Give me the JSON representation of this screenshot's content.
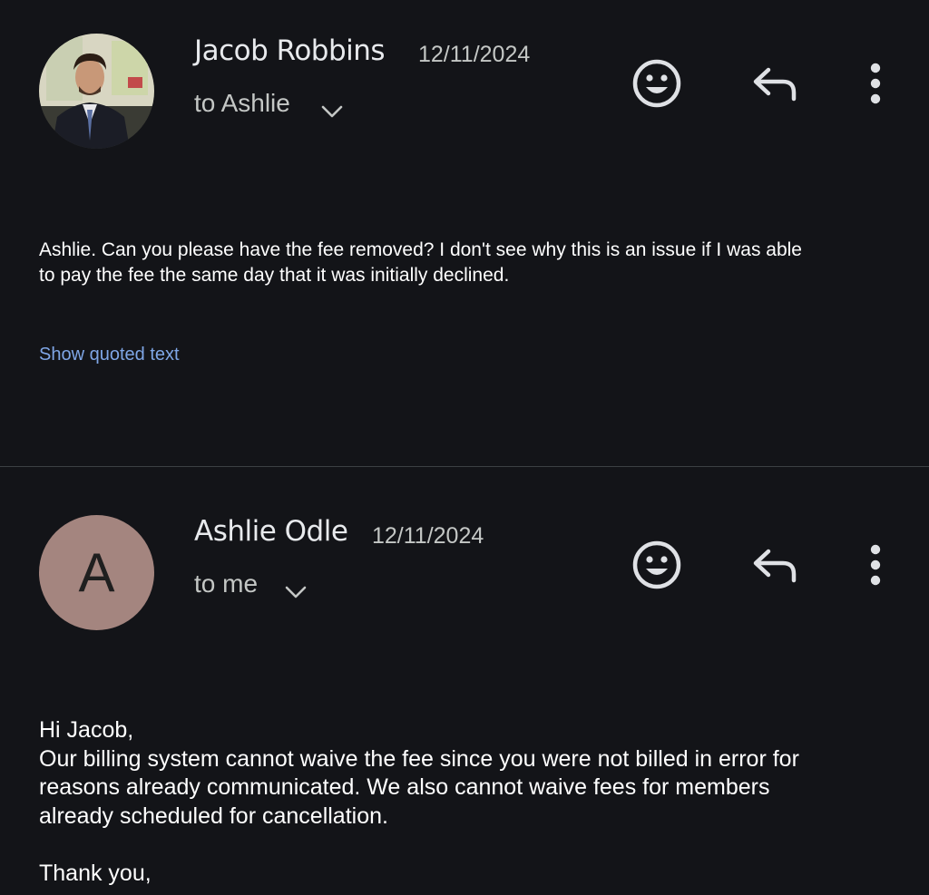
{
  "messages": [
    {
      "sender": "Jacob Robbins",
      "date": "12/11/2024",
      "recipient": "to Ashlie",
      "avatar": {
        "type": "photo",
        "icon": "person-photo"
      },
      "body_lines": [
        "Ashlie. Can you please have the fee removed? I don't see why this is an issue if I was able",
        "to pay the fee the same day that it was initially declined."
      ],
      "quoted_link": "Show quoted text"
    },
    {
      "sender": "Ashlie Odle",
      "date": "12/11/2024",
      "recipient": "to me",
      "avatar": {
        "type": "letter",
        "letter": "A",
        "color": "#a4857f"
      },
      "body_lines": [
        "Hi Jacob,",
        "Our billing system cannot waive the fee since you were not billed in error for",
        "reasons already communicated. We also cannot waive fees for members",
        "already scheduled for cancellation.",
        "",
        "Thank you,"
      ]
    }
  ],
  "icons": {
    "emoji": "smiley-icon",
    "reply": "reply-arrow-icon",
    "more": "more-vert-icon",
    "expand": "chevron-down-icon"
  },
  "colors": {
    "background": "#131418",
    "link": "#7fa6e6",
    "icon": "#dfe1e5"
  }
}
